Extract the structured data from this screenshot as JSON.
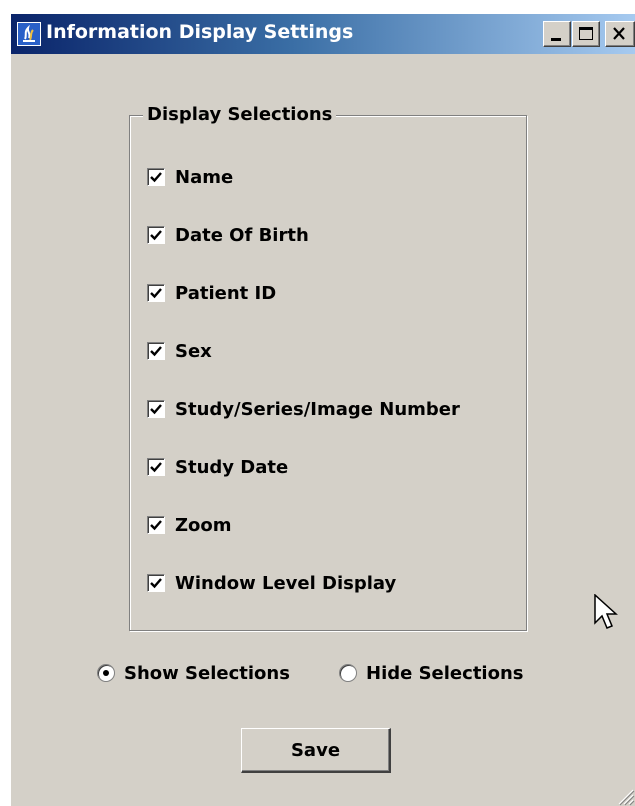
{
  "window": {
    "title": "Information Display Settings"
  },
  "icons": {
    "app": "java-app-icon",
    "minimize": "minimize-icon",
    "maximize": "maximize-icon",
    "close": "close-icon",
    "resize_grip": "resize-grip-icon",
    "cursor": "mouse-pointer-icon"
  },
  "colors": {
    "window_bg": "#d4d0c8",
    "title_gradient_start": "#0a246a",
    "title_gradient_end": "#a6caf0",
    "title_text": "#ffffff"
  },
  "display_selections": {
    "legend": "Display Selections",
    "items": [
      {
        "label": "Name",
        "checked": true
      },
      {
        "label": "Date Of Birth",
        "checked": true
      },
      {
        "label": "Patient ID",
        "checked": true
      },
      {
        "label": "Sex",
        "checked": true
      },
      {
        "label": "Study/Series/Image Number",
        "checked": true
      },
      {
        "label": "Study Date",
        "checked": true
      },
      {
        "label": "Zoom",
        "checked": true
      },
      {
        "label": "Window Level Display",
        "checked": true
      }
    ]
  },
  "visibility": {
    "show_label": "Show Selections",
    "hide_label": "Hide Selections",
    "selected": "show"
  },
  "actions": {
    "save_label": "Save"
  }
}
